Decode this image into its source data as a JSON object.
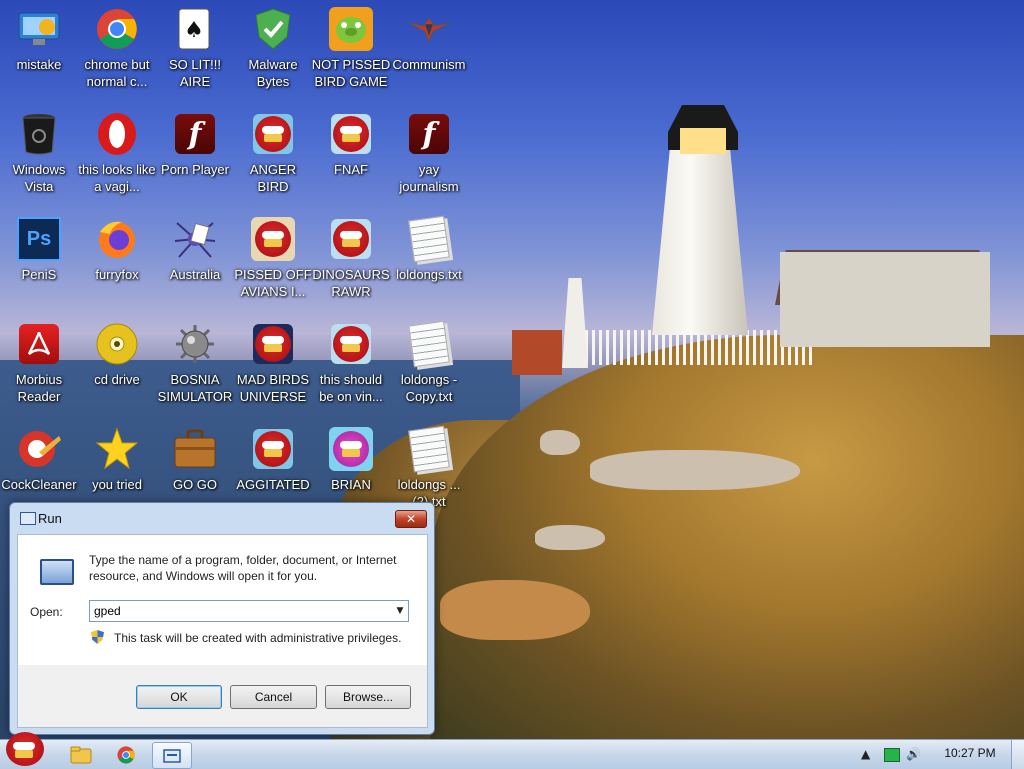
{
  "desktop": {
    "icons": [
      {
        "label": "mistake",
        "icon": "computer-icon"
      },
      {
        "label": "chrome but normal c...",
        "icon": "chrome-icon"
      },
      {
        "label": "SO LIT!!! AIRE",
        "icon": "solitaire-icon"
      },
      {
        "label": "Malware Bytes",
        "icon": "shield-icon"
      },
      {
        "label": "NOT PISSED BIRD GAME",
        "icon": "pig-icon"
      },
      {
        "label": "Communism",
        "icon": "emblem-icon"
      },
      {
        "label": "Windows Vista",
        "icon": "trash-icon"
      },
      {
        "label": "this looks like a vagi...",
        "icon": "opera-icon"
      },
      {
        "label": "Porn Player",
        "icon": "flash-icon"
      },
      {
        "label": "ANGER BIRD",
        "icon": "angry-bird-icon"
      },
      {
        "label": "FNAF",
        "icon": "angry-bird-icon"
      },
      {
        "label": "yay journalism",
        "icon": "flash-icon"
      },
      {
        "label": "PeniS",
        "icon": "photoshop-icon"
      },
      {
        "label": "furryfox",
        "icon": "firefox-icon"
      },
      {
        "label": "Australia",
        "icon": "spider-icon"
      },
      {
        "label": "PISSED OFF AVIANS I...",
        "icon": "seasons-bird-icon"
      },
      {
        "label": "DINOSAURS RAWR",
        "icon": "angry-bird-icon"
      },
      {
        "label": "loldongs.txt",
        "icon": "text-file-icon"
      },
      {
        "label": "Morbius Reader",
        "icon": "pdf-icon"
      },
      {
        "label": "cd drive",
        "icon": "cd-icon"
      },
      {
        "label": "BOSNIA SIMULATOR",
        "icon": "mine-icon"
      },
      {
        "label": "MAD BIRDS UNIVERSE",
        "icon": "space-bird-icon"
      },
      {
        "label": "this should be on vin...",
        "icon": "angry-bird-icon"
      },
      {
        "label": "loldongs - Copy.txt",
        "icon": "text-file-icon"
      },
      {
        "label": "CockCleaner",
        "icon": "ccleaner-icon"
      },
      {
        "label": "you tried",
        "icon": "star-icon"
      },
      {
        "label": "GO GO",
        "icon": "briefcase-icon"
      },
      {
        "label": "AGGITATED",
        "icon": "angry-bird-icon"
      },
      {
        "label": "BRIAN",
        "icon": "hat-bird-icon"
      },
      {
        "label": "loldongs ... (2).txt",
        "icon": "text-file-icon"
      }
    ]
  },
  "run_dialog": {
    "title": "Run",
    "close_label": "✕",
    "description": "Type the name of a program, folder, document, or Internet resource, and Windows will open it for you.",
    "open_label": "Open:",
    "open_value": "gped",
    "admin_note": "This task will be created with administrative privileges.",
    "ok_label": "OK",
    "cancel_label": "Cancel",
    "browse_label": "Browse..."
  },
  "taskbar": {
    "start_icon": "angry-bird-icon",
    "pinned": [
      "explorer-icon",
      "chrome-icon",
      "run-icon"
    ],
    "tray_expand": "▲",
    "clock": "10:27 PM"
  }
}
